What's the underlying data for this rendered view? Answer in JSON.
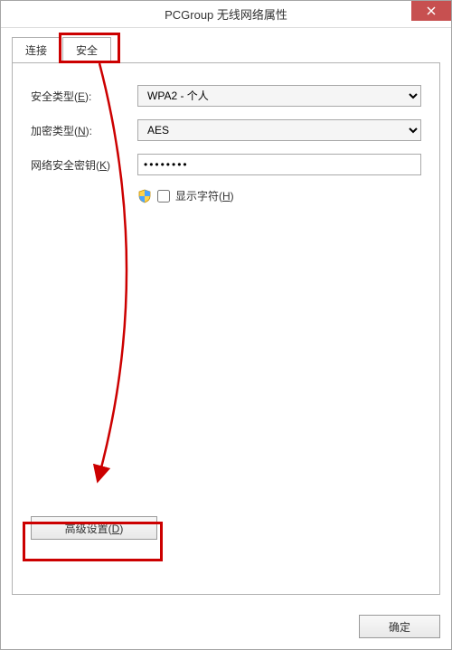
{
  "window": {
    "title": "PCGroup 无线网络属性"
  },
  "tabs": {
    "connect": "连接",
    "security": "安全"
  },
  "labels": {
    "security_type": "安全类型(E):",
    "encryption_type": "加密类型(N):",
    "network_key": "网络安全密钥(K)",
    "show_chars": "显示字符(H)"
  },
  "values": {
    "security_type": "WPA2 - 个人",
    "encryption_type": "AES",
    "network_key": "••••••••"
  },
  "buttons": {
    "advanced": "高级设置(D)",
    "ok": "确定"
  }
}
